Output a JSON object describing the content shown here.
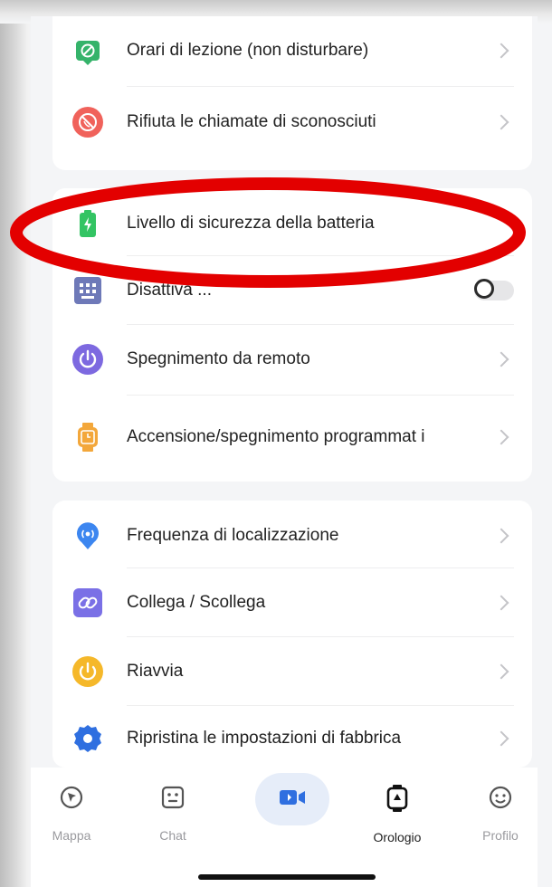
{
  "settings": {
    "group1": [
      {
        "label": "Orari di lezione (non disturbare)",
        "icon": "class-schedule-icon"
      },
      {
        "label": "Rifiuta le chiamate di sconosciuti",
        "icon": "block-calls-icon"
      }
    ],
    "group2": [
      {
        "label": "Livello di sicurezza della batteria",
        "icon": "battery-icon"
      },
      {
        "label": "Disattiva ...",
        "icon": "keyboard-icon",
        "toggle_on": false
      },
      {
        "label": "Spegnimento da remoto",
        "icon": "power-icon"
      },
      {
        "label": "Accensione/spegnimento programmat i",
        "icon": "watch-timer-icon"
      }
    ],
    "group3": [
      {
        "label": "Frequenza di localizzazione",
        "icon": "location-pin-icon"
      },
      {
        "label": "Collega / Scollega",
        "icon": "link-icon"
      },
      {
        "label": "Riavvia",
        "icon": "restart-icon"
      },
      {
        "label": "Ripristina le impostazioni di fabbrica",
        "icon": "gear-icon"
      }
    ]
  },
  "tabbar": {
    "tabs": [
      {
        "label": "Mappa",
        "icon": "compass-icon"
      },
      {
        "label": "Chat",
        "icon": "chat-face-icon"
      },
      {
        "label": "",
        "icon": "video-camera-icon"
      },
      {
        "label": "Orologio",
        "icon": "smartwatch-icon",
        "active": true
      },
      {
        "label": "Profilo",
        "icon": "smiley-icon"
      }
    ]
  },
  "colors": {
    "annotation": "#e30000",
    "accent": "#2f6fe0",
    "background": "#f4f5f7"
  }
}
